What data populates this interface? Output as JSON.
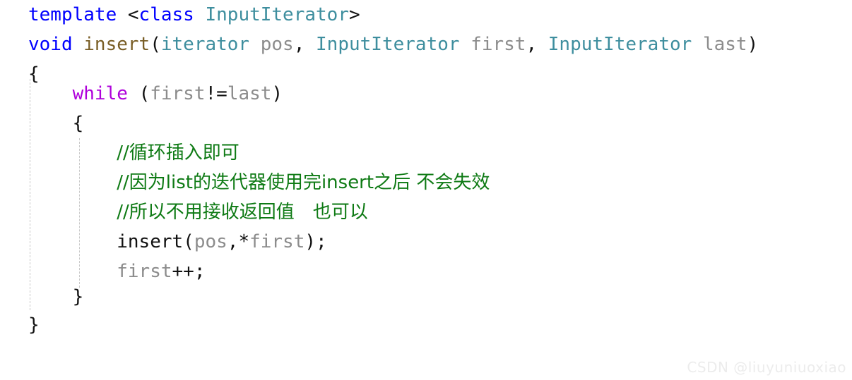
{
  "editor": {
    "language": "cpp",
    "background_color": "#ffffff",
    "indent_guide_color": "#c8c8c8",
    "font_size_px": 26,
    "line_height_px": 42
  },
  "palette": {
    "keyword": "#0000ff",
    "control_keyword": "#af00db",
    "type_name": "#3e8e9e",
    "function_declaration": "#795e26",
    "variable": "#8c8c8c",
    "punctuation": "#111111",
    "comment": "#008000"
  },
  "code": {
    "line1": {
      "keyword_template": "template",
      "open_angle": " <",
      "keyword_class": "class",
      "space": " ",
      "type_inputiterator": "InputIterator",
      "close_angle": ">"
    },
    "line2": {
      "keyword_void": "void",
      "space1": " ",
      "func_insert": "insert",
      "paren_open": "(",
      "type_iterator": "iterator",
      "space2": " ",
      "var_pos": "pos",
      "comma1": ", ",
      "type_inputiterator1": "InputIterator",
      "space3": " ",
      "var_first": "first",
      "comma2": ", ",
      "type_inputiterator2": "InputIterator",
      "space4": " ",
      "var_last": "last",
      "paren_close": ")"
    },
    "line3": {
      "brace": "{"
    },
    "line4": {
      "indent": "    ",
      "keyword_while": "while",
      "space": " ",
      "paren_open": "(",
      "var_first": "first",
      "operator_neq": "!=",
      "var_last": "last",
      "paren_close": ")"
    },
    "line5": {
      "indent": "    ",
      "brace": "{"
    },
    "line6": {
      "indent": "        ",
      "comment": "//循环插入即可"
    },
    "line7": {
      "indent": "        ",
      "comment": "//因为list的迭代器使用完insert之后 不会失效"
    },
    "line8": {
      "indent": "        ",
      "comment": "//所以不用接收返回值　也可以"
    },
    "line9": {
      "indent": "        ",
      "call_insert": "insert",
      "paren_open": "(",
      "var_pos": "pos",
      "comma": ",",
      "star": "*",
      "var_first": "first",
      "paren_close": ")",
      "semicolon": ";"
    },
    "line10": {
      "indent": "        ",
      "var_first": "first",
      "operator_inc": "++",
      "semicolon": ";"
    },
    "line11": {
      "indent": "    ",
      "brace": "}"
    },
    "line12": {
      "brace": "}"
    }
  },
  "watermark": {
    "text": "CSDN @liuyuniuoxiao"
  }
}
